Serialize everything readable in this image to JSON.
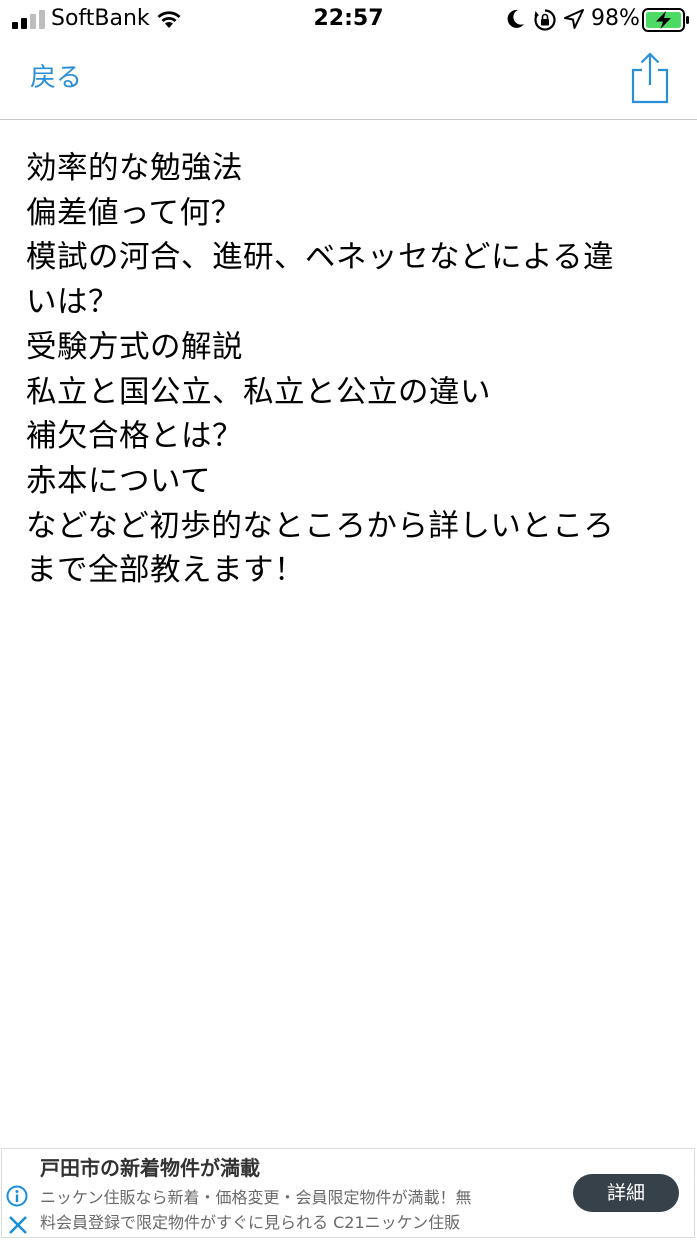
{
  "status_bar": {
    "carrier": "SoftBank",
    "time": "22:57",
    "battery_percent": "98%",
    "icons": [
      "signal-icon",
      "wifi-icon",
      "moon-icon",
      "rotation-lock-icon",
      "location-icon",
      "battery-charging-icon"
    ]
  },
  "nav": {
    "back_label": "戻る",
    "share_icon": "share-icon",
    "accent_color": "#2b8fd8"
  },
  "content": {
    "lines": [
      "効率的な勉強法",
      "偏差値って何？",
      "模試の河合、進研、ベネッセなどによる違",
      "いは？",
      "受験方式の解説",
      "私立と国公立、私立と公立の違い",
      "補欠合格とは？",
      "赤本について",
      "などなど初歩的なところから詳しいところ",
      "まで全部教えます！"
    ]
  },
  "ad": {
    "title": "戸田市の新着物件が満載",
    "description_lines": [
      "ニッケン住販なら新着・価格変更・会員限定物件が満載！無",
      "料会員登録で限定物件がすぐに見られる C21ニッケン住販"
    ],
    "button_label": "詳細",
    "icons": [
      "info-icon",
      "close-icon"
    ],
    "button_color": "#37414a"
  }
}
